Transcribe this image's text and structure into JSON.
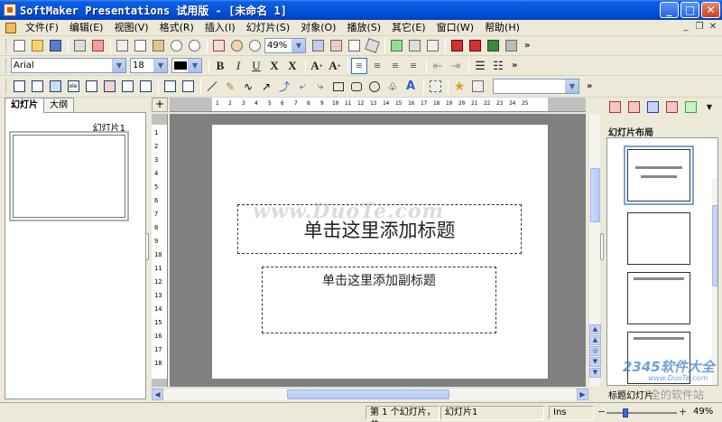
{
  "window": {
    "title": "SoftMaker Presentations 试用版 - [未命名 1]"
  },
  "menu": {
    "items": [
      "文件(F)",
      "编辑(E)",
      "视图(V)",
      "格式(R)",
      "插入(I)",
      "幻灯片(S)",
      "对象(O)",
      "播放(S)",
      "其它(E)",
      "窗口(W)",
      "帮助(H)"
    ]
  },
  "toolbar_format": {
    "font_name": "Arial",
    "font_size": "18"
  },
  "toolbar_standard": {
    "zoom": "49%"
  },
  "toolbar_objects": {
    "combo_value": ""
  },
  "left_panel": {
    "tabs": [
      "幻灯片",
      "大纲"
    ],
    "slide_label": "幻灯片1"
  },
  "ruler": {
    "h_ticks": [
      "1",
      "2",
      "3",
      "4",
      "5",
      "6",
      "7",
      "8",
      "9",
      "10",
      "11",
      "12",
      "13",
      "14",
      "15",
      "16",
      "17",
      "18",
      "19",
      "20",
      "21",
      "22",
      "23",
      "24",
      "25"
    ],
    "v_ticks": [
      "1",
      "2",
      "3",
      "4",
      "5",
      "6",
      "7",
      "8",
      "9",
      "10",
      "11",
      "12",
      "13",
      "14",
      "15",
      "16",
      "17",
      "18"
    ]
  },
  "slide": {
    "title_placeholder": "单击这里添加标题",
    "subtitle_placeholder": "单击这里添加副标题"
  },
  "right_panel": {
    "title": "幻灯片布局",
    "bottom_label": "标题幻灯片"
  },
  "status": {
    "slide_pos": "第 1 个幻灯片，共",
    "slide_name": "幻灯片1",
    "mode": "Ins",
    "zoom": "49%"
  },
  "watermarks": {
    "center": "www.DuoTe.com",
    "brand": "2345软件大全",
    "brand_url": "www.DuoTe.com",
    "brand_sub": "全的软件站"
  }
}
